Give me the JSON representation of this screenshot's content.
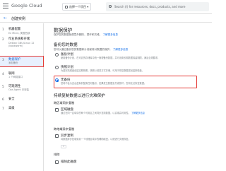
{
  "topbar": {
    "logo_text": "Google Cloud",
    "project_label": "选择一个项目",
    "search_placeholder": "Search (/) for resources, docs, products, and more"
  },
  "subheader": {
    "back_glyph": "←",
    "title": "创建实例"
  },
  "sidebar": {
    "steps": [
      {
        "num": "1",
        "title": "机器配置",
        "subtitle": "E2 Micro, 美国西部"
      },
      {
        "num": "2",
        "title": "作业系统和存储",
        "subtitle": "Debian GNU/Linux 12",
        "subtitle2": "(bookworm)"
      },
      {
        "num": "3",
        "title": "数据保护",
        "subtitle": "添加备份"
      },
      {
        "num": "4",
        "title": "联网",
        "subtitle": "1 个网络接口"
      },
      {
        "num": "5",
        "title": "可观测性",
        "subtitle": "Ops Agent 已安装"
      },
      {
        "num": "6",
        "title": "安全",
        "subtitle": ""
      },
      {
        "num": "7",
        "title": "高级",
        "subtitle": ""
      }
    ]
  },
  "main": {
    "title": "数据保护",
    "intro": "保护您的数据免遭意外删除、损坏和灾难。",
    "intro_link": "了解更多信息",
    "section1_title": "备份您的数据",
    "section1_desc": "您可以通过备份您的数据和计划保持对数据的保护。",
    "section1_link": "了解更多信息",
    "options": [
      {
        "label": "备份计划",
        "desc": "使用备份计划，在可靠的存储库中统一管理备份数据，并可设置长期数据保留期限，满足合规要求。"
      },
      {
        "label": "快照计划",
        "desc": "为虚拟机磁盘创建定期快照，快照以增量方式存储，可用于恢复数据或创建新磁盘。"
      },
      {
        "label": "无备份",
        "desc": "您将不会为这台虚拟机配置任何备份，如果发生数据丢失或损坏，您将无法恢复数据。"
      }
    ],
    "selected_option": "无备份",
    "section2_title": "持续复制数据以进行灾难保护",
    "section3_title": "跨区域同步复制",
    "section3_checkbox": "区域磁盘",
    "section3_desc": "通过在同一区域中的两个可用区之间同步复制数据，以实现高可用性。",
    "section3_link": "了解更多信息",
    "section4_title": "跨地域异步复制",
    "section4_checkbox": "异步复制",
    "section4_desc": "将数据异步复制到另一个地理区域中的辅助磁盘，以便进行灾难恢复。",
    "section5_title": "排除",
    "section5_checkbox": "排除此磁盘"
  },
  "colors": {
    "accent": "#1a73e8",
    "highlight": "#e53935",
    "active_bg": "#e8f0fe"
  }
}
